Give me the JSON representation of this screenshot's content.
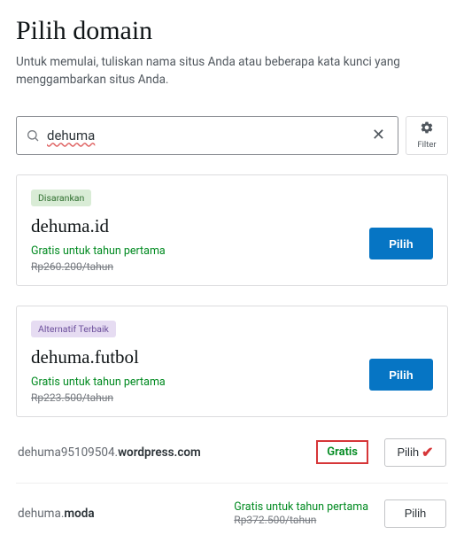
{
  "header": {
    "title": "Pilih domain",
    "subtitle": "Untuk memulai, tuliskan nama situs Anda atau beberapa kata kunci yang menggambarkan situs Anda."
  },
  "search": {
    "value": "dehuma",
    "filter_label": "Filter"
  },
  "cards": [
    {
      "badge": "Disarankan",
      "domain": "dehuma.id",
      "free_text": "Gratis untuk tahun pertama",
      "old_price": "Rp260.200/tahun",
      "button": "Pilih"
    },
    {
      "badge": "Alternatif Terbaik",
      "domain": "dehuma.futbol",
      "free_text": "Gratis untuk tahun pertama",
      "old_price": "Rp223.500/tahun",
      "button": "Pilih"
    }
  ],
  "rows": [
    {
      "prefix": "dehuma95109504.",
      "bold": "wordpress.com",
      "mid_top": "Gratis",
      "mid_bottom": "",
      "button": "Pilih",
      "highlight": true,
      "check": true
    },
    {
      "prefix": "dehuma.",
      "bold": "moda",
      "mid_top": "Gratis untuk tahun pertama",
      "mid_bottom": "Rp372.500/tahun",
      "button": "Pilih",
      "highlight": false,
      "check": false
    }
  ]
}
